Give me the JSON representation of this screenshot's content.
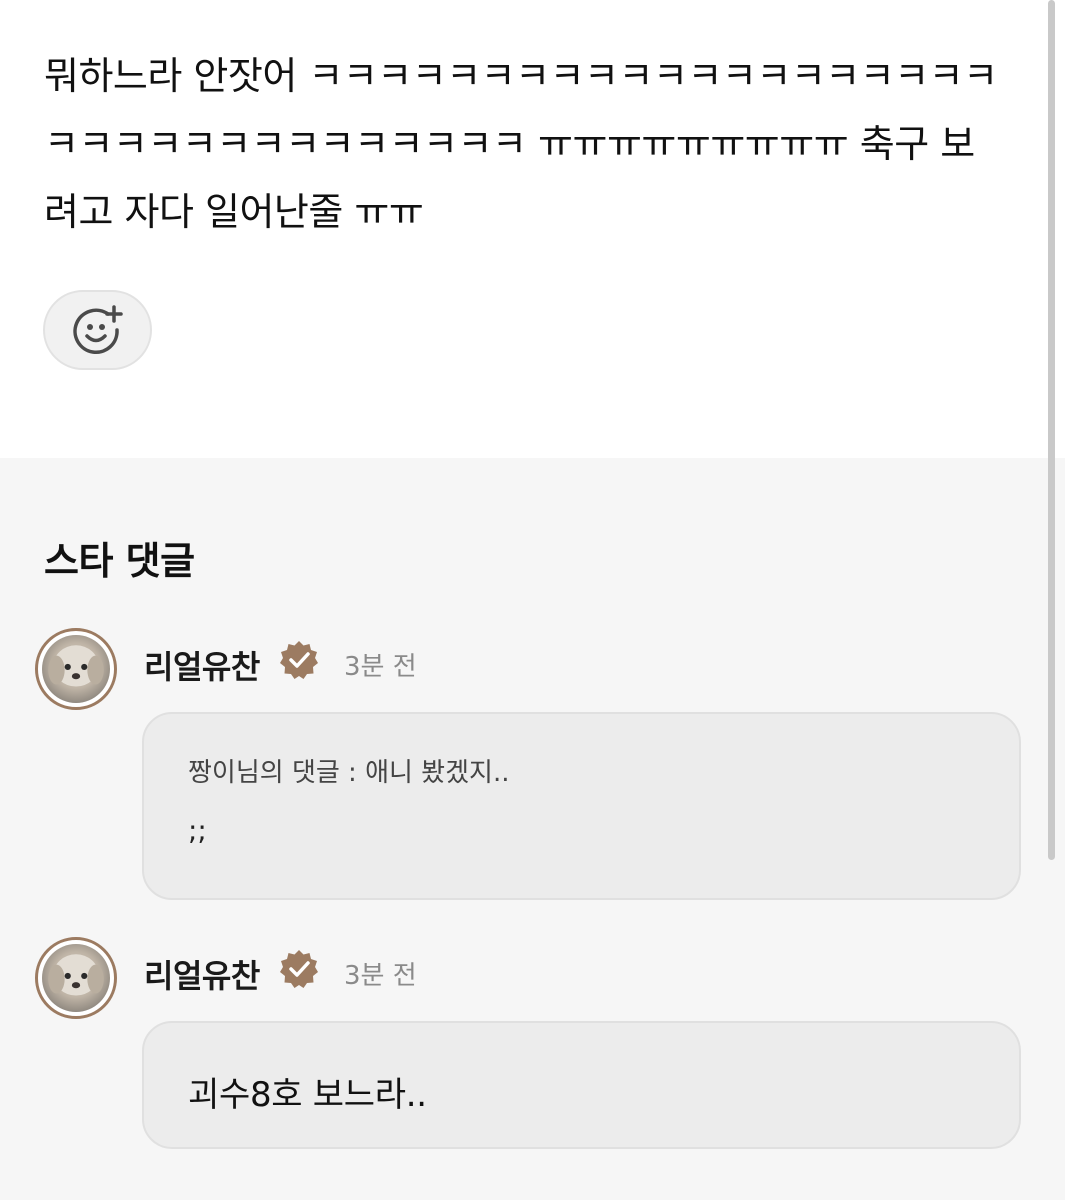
{
  "post": {
    "text": "뭐하느라 안잣어 ㅋㅋㅋㅋㅋㅋㅋㅋㅋㅋㅋㅋㅋㅋㅋㅋㅋㅋㅋㅋㅋㅋㅋㅋㅋㅋㅋㅋㅋㅋㅋㅋㅋㅋ ㅠㅠㅠㅠㅠㅠㅠㅠㅠ 축구 보려고 자다 일어난줄 ㅠㅠ",
    "reaction_icon": "add-emoji-icon"
  },
  "comments_section": {
    "title": "스타 댓글",
    "comments": [
      {
        "username": "리얼유찬",
        "verified_icon": "verified-badge-icon",
        "time": "3분 전",
        "quote": "짱이님의 댓글 : 애니 봤겠지..",
        "text": ";;"
      },
      {
        "username": "리얼유찬",
        "verified_icon": "verified-badge-icon",
        "time": "3분 전",
        "text": "괴수8호 보느라.."
      }
    ]
  },
  "colors": {
    "badge": "#9c7b61",
    "section_background": "#f6f6f6",
    "bubble_background": "#ececec"
  }
}
